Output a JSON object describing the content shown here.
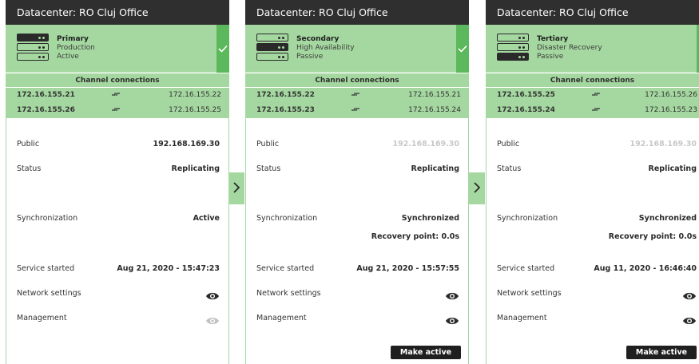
{
  "cards": [
    {
      "datacenter": "Datacenter: RO Cluj Office",
      "role": "Primary",
      "type": "Production",
      "state": "Active",
      "server_icon_active_index": 0,
      "channels_title": "Channel connections",
      "channels": [
        {
          "left": "172.16.155.21",
          "right": "172.16.155.22"
        },
        {
          "left": "172.16.155.26",
          "right": "172.16.155.25"
        }
      ],
      "public_label": "Public",
      "public_value": "192.168.169.30",
      "status_label": "Status",
      "status_value": "Replicating",
      "sync_label": "Synchronization",
      "sync_value": "Active",
      "recovery": "",
      "service_label": "Service started",
      "service_value": "Aug 21, 2020 - 15:47:23",
      "network_label": "Network settings",
      "management_label": "Management",
      "action": ""
    },
    {
      "datacenter": "Datacenter: RO Cluj Office",
      "role": "Secondary",
      "type": "High Availability",
      "state": "Passive",
      "server_icon_active_index": 1,
      "channels_title": "Channel connections",
      "channels": [
        {
          "left": "172.16.155.22",
          "right": "172.16.155.21"
        },
        {
          "left": "172.16.155.23",
          "right": "172.16.155.24"
        }
      ],
      "public_label": "Public",
      "public_value": "192.168.169.30",
      "status_label": "Status",
      "status_value": "Replicating",
      "sync_label": "Synchronization",
      "sync_value": "Synchronized",
      "recovery": "Recovery point: 0.0s",
      "service_label": "Service started",
      "service_value": "Aug 21, 2020 - 15:57:55",
      "network_label": "Network settings",
      "management_label": "Management",
      "action": "Make active"
    },
    {
      "datacenter": "Datacenter: RO Cluj Office",
      "role": "Tertiary",
      "type": "Disaster Recovery",
      "state": "Passive",
      "server_icon_active_index": 2,
      "channels_title": "Channel connections",
      "channels": [
        {
          "left": "172.16.155.25",
          "right": "172.16.155.26"
        },
        {
          "left": "172.16.155.24",
          "right": "172.16.155.23"
        }
      ],
      "public_label": "Public",
      "public_value": "192.168.169.30",
      "status_label": "Status",
      "status_value": "Replicating",
      "sync_label": "Synchronization",
      "sync_value": "Synchronized",
      "recovery": "Recovery point: 0.0s",
      "service_label": "Service started",
      "service_value": "Aug 11, 2020 - 16:46:40",
      "network_label": "Network settings",
      "management_label": "Management",
      "action": "Make active"
    }
  ],
  "icons": {
    "server": "server-rack-icon",
    "check": "checkmark-icon",
    "link": "channel-link-icon",
    "eye": "eye-icon",
    "arrow": "chevron-right-icon"
  },
  "colors": {
    "header_bg": "#2f2f2f",
    "accent_green": "#a5d8a0",
    "check_green": "#5cb85c",
    "button_bg": "#1f1f1f"
  }
}
